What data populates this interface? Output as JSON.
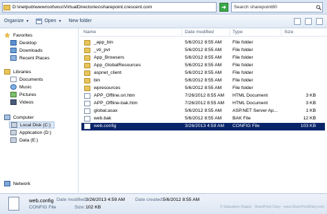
{
  "address": {
    "path": "D:\\inetpub\\wwwroot\\wss\\VirtualDirectories\\sharepoint.crescent.com"
  },
  "search": {
    "placeholder": "Search sharepoint80"
  },
  "toolbar": {
    "organize": "Organize",
    "open": "Open",
    "new_folder": "New folder"
  },
  "nav": {
    "favorites": "Favorites",
    "desktop": "Desktop",
    "downloads": "Downloads",
    "recent_places": "Recent Places",
    "libraries": "Libraries",
    "documents": "Documents",
    "music": "Music",
    "pictures": "Pictures",
    "videos": "Videos",
    "computer": "Computer",
    "local_disk": "Local Disk (C:)",
    "application": "Application (D:)",
    "data": "Data (E:)",
    "network": "Network"
  },
  "columns": {
    "name": "Name",
    "date": "Date modified",
    "type": "Type",
    "size": "Size"
  },
  "files": [
    {
      "name": "_app_bin",
      "date": "5/6/2012 8:55 AM",
      "type": "File folder",
      "size": "",
      "icon": "folder-icon"
    },
    {
      "name": "_vti_pvt",
      "date": "5/6/2012 8:55 AM",
      "type": "File folder",
      "size": "",
      "icon": "folder-icon"
    },
    {
      "name": "App_Browsers",
      "date": "5/6/2012 8:55 AM",
      "type": "File folder",
      "size": "",
      "icon": "folder-icon"
    },
    {
      "name": "App_GlobalResources",
      "date": "5/6/2012 8:55 AM",
      "type": "File folder",
      "size": "",
      "icon": "folder-icon"
    },
    {
      "name": "aspnet_client",
      "date": "5/6/2012 8:55 AM",
      "type": "File folder",
      "size": "",
      "icon": "folder-icon"
    },
    {
      "name": "bin",
      "date": "5/6/2012 8:55 AM",
      "type": "File folder",
      "size": "",
      "icon": "folder-icon"
    },
    {
      "name": "wpresources",
      "date": "5/6/2012 8:55 AM",
      "type": "File folder",
      "size": "",
      "icon": "folder-icon"
    },
    {
      "name": "APP_Offline.ori.htm",
      "date": "7/26/2012 8:55 AM",
      "type": "HTML Document",
      "size": "3 KB",
      "icon": "html-file-icon"
    },
    {
      "name": "APP_Offline-bak.htm",
      "date": "7/26/2012 8:55 AM",
      "type": "HTML Document",
      "size": "3 KB",
      "icon": "html-file-icon"
    },
    {
      "name": "global.asax",
      "date": "5/6/2012 8:55 AM",
      "type": "ASP.NET Server Ap...",
      "size": "1 KB",
      "icon": "asax-file-icon"
    },
    {
      "name": "web.bak",
      "date": "5/6/2012 8:55 AM",
      "type": "BAK File",
      "size": "12 KB",
      "icon": "file-icon"
    },
    {
      "name": "web.config",
      "date": "3/26/2013 4:59 AM",
      "type": "CONFIG File",
      "size": "103 KB",
      "icon": "config-file-icon"
    }
  ],
  "details": {
    "name": "web.config",
    "type": "CONFIG File",
    "date_modified_label": "Date modified:",
    "date_modified": "3/26/2013 4:59 AM",
    "size_label": "Size:",
    "size": "102 KB",
    "date_created_label": "Date created:",
    "date_created": "5/6/2012 8:55 AM",
    "watermark": "© Salaudeen Rajack · SharePoint Diary · www.SharePointDiary.com"
  },
  "colors": {
    "selection": "#0a246a",
    "folder": "#e8c45a",
    "go_button": "#3aa84a"
  }
}
